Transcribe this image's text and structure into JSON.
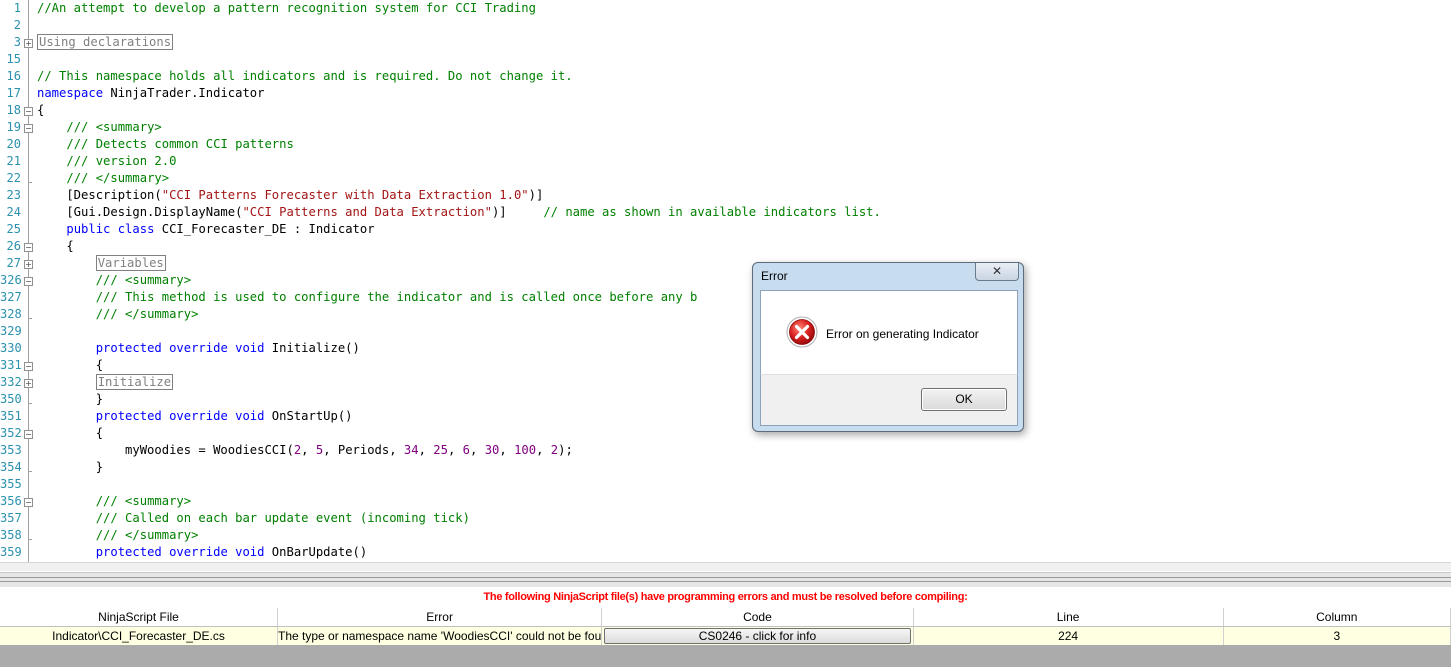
{
  "editor": {
    "lines": [
      {
        "num": "1",
        "segs": [
          [
            "c",
            "//An attempt to develop a pattern recognition system for CCI Trading"
          ]
        ]
      },
      {
        "num": "2",
        "segs": []
      },
      {
        "num": "3",
        "segs": [
          [
            "box",
            "Using declarations"
          ]
        ]
      },
      {
        "num": "15",
        "segs": []
      },
      {
        "num": "16",
        "segs": [
          [
            "c",
            "// This namespace holds all indicators and is required. Do not change it."
          ]
        ]
      },
      {
        "num": "17",
        "segs": [
          [
            "k",
            "namespace"
          ],
          [
            "t",
            " NinjaTrader.Indicator"
          ]
        ]
      },
      {
        "num": "18",
        "segs": [
          [
            "t",
            "{"
          ]
        ]
      },
      {
        "num": "19",
        "segs": [
          [
            "t",
            "    "
          ],
          [
            "c",
            "/// <summary>"
          ]
        ]
      },
      {
        "num": "20",
        "segs": [
          [
            "t",
            "    "
          ],
          [
            "c",
            "/// Detects common CCI patterns"
          ]
        ]
      },
      {
        "num": "21",
        "segs": [
          [
            "t",
            "    "
          ],
          [
            "c",
            "/// version 2.0"
          ]
        ]
      },
      {
        "num": "22",
        "segs": [
          [
            "t",
            "    "
          ],
          [
            "c",
            "/// </summary>"
          ]
        ]
      },
      {
        "num": "23",
        "segs": [
          [
            "t",
            "    [Description("
          ],
          [
            "s",
            "\"CCI Patterns Forecaster with Data Extraction 1.0\""
          ],
          [
            "t",
            ")]"
          ]
        ]
      },
      {
        "num": "24",
        "segs": [
          [
            "t",
            "    [Gui.Design.DisplayName("
          ],
          [
            "s",
            "\"CCI Patterns and Data Extraction\""
          ],
          [
            "t",
            ")]     "
          ],
          [
            "c",
            "// name as shown in available indicators list."
          ]
        ]
      },
      {
        "num": "25",
        "segs": [
          [
            "t",
            "    "
          ],
          [
            "k",
            "public class"
          ],
          [
            "t",
            " CCI_Forecaster_DE : Indicator"
          ]
        ]
      },
      {
        "num": "26",
        "segs": [
          [
            "t",
            "    {"
          ]
        ]
      },
      {
        "num": "27",
        "segs": [
          [
            "t",
            "        "
          ],
          [
            "box",
            "Variables"
          ]
        ]
      },
      {
        "num": "326",
        "segs": [
          [
            "t",
            "        "
          ],
          [
            "c",
            "/// <summary>"
          ]
        ]
      },
      {
        "num": "327",
        "segs": [
          [
            "t",
            "        "
          ],
          [
            "c",
            "/// This method is used to configure the indicator and is called once before any b"
          ]
        ]
      },
      {
        "num": "328",
        "segs": [
          [
            "t",
            "        "
          ],
          [
            "c",
            "/// </summary>"
          ]
        ]
      },
      {
        "num": "329",
        "segs": []
      },
      {
        "num": "330",
        "segs": [
          [
            "t",
            "        "
          ],
          [
            "k",
            "protected override void"
          ],
          [
            "t",
            " Initialize()"
          ]
        ]
      },
      {
        "num": "331",
        "segs": [
          [
            "t",
            "        {"
          ]
        ]
      },
      {
        "num": "332",
        "segs": [
          [
            "t",
            "        "
          ],
          [
            "box",
            "Initialize"
          ]
        ]
      },
      {
        "num": "350",
        "segs": [
          [
            "t",
            "        }"
          ]
        ]
      },
      {
        "num": "351",
        "segs": [
          [
            "t",
            "        "
          ],
          [
            "k",
            "protected override void"
          ],
          [
            "t",
            " OnStartUp()"
          ]
        ]
      },
      {
        "num": "352",
        "segs": [
          [
            "t",
            "        {"
          ]
        ]
      },
      {
        "num": "353",
        "segs": [
          [
            "t",
            "            myWoodies = WoodiesCCI("
          ],
          [
            "n",
            "2"
          ],
          [
            "t",
            ", "
          ],
          [
            "n",
            "5"
          ],
          [
            "t",
            ", Periods, "
          ],
          [
            "n",
            "34"
          ],
          [
            "t",
            ", "
          ],
          [
            "n",
            "25"
          ],
          [
            "t",
            ", "
          ],
          [
            "n",
            "6"
          ],
          [
            "t",
            ", "
          ],
          [
            "n",
            "30"
          ],
          [
            "t",
            ", "
          ],
          [
            "n",
            "100"
          ],
          [
            "t",
            ", "
          ],
          [
            "n",
            "2"
          ],
          [
            "t",
            ");"
          ]
        ]
      },
      {
        "num": "354",
        "segs": [
          [
            "t",
            "        }"
          ]
        ]
      },
      {
        "num": "355",
        "segs": []
      },
      {
        "num": "356",
        "segs": [
          [
            "t",
            "        "
          ],
          [
            "c",
            "/// <summary>"
          ]
        ]
      },
      {
        "num": "357",
        "segs": [
          [
            "t",
            "        "
          ],
          [
            "c",
            "/// Called on each bar update event (incoming tick)"
          ]
        ]
      },
      {
        "num": "358",
        "segs": [
          [
            "t",
            "        "
          ],
          [
            "c",
            "/// </summary>"
          ]
        ]
      },
      {
        "num": "359",
        "segs": [
          [
            "t",
            "        "
          ],
          [
            "k",
            "protected override void"
          ],
          [
            "t",
            " OnBarUpdate()"
          ]
        ]
      }
    ]
  },
  "error_panel": {
    "message": "The following NinjaScript file(s) have programming errors and must be resolved before compiling:",
    "columns": [
      "NinjaScript File",
      "Error",
      "Code",
      "Line",
      "Column"
    ],
    "rows": [
      {
        "file": "Indicator\\CCI_Forecaster_DE.cs",
        "error": "The type or namespace name 'WoodiesCCI' could not be fou",
        "code": "CS0246 - click for info",
        "line": "224",
        "column": "3"
      }
    ]
  },
  "dialog": {
    "title": "Error",
    "close_glyph": "✕",
    "message": "Error on generating Indicator",
    "ok_label": "OK"
  },
  "colors": {
    "comment": "#008000",
    "keyword": "#0000ff",
    "string": "#a31515",
    "number": "#800080",
    "line_number": "#2b91af",
    "error_text": "#ff0000",
    "error_row_bg": "#ffffe1"
  }
}
